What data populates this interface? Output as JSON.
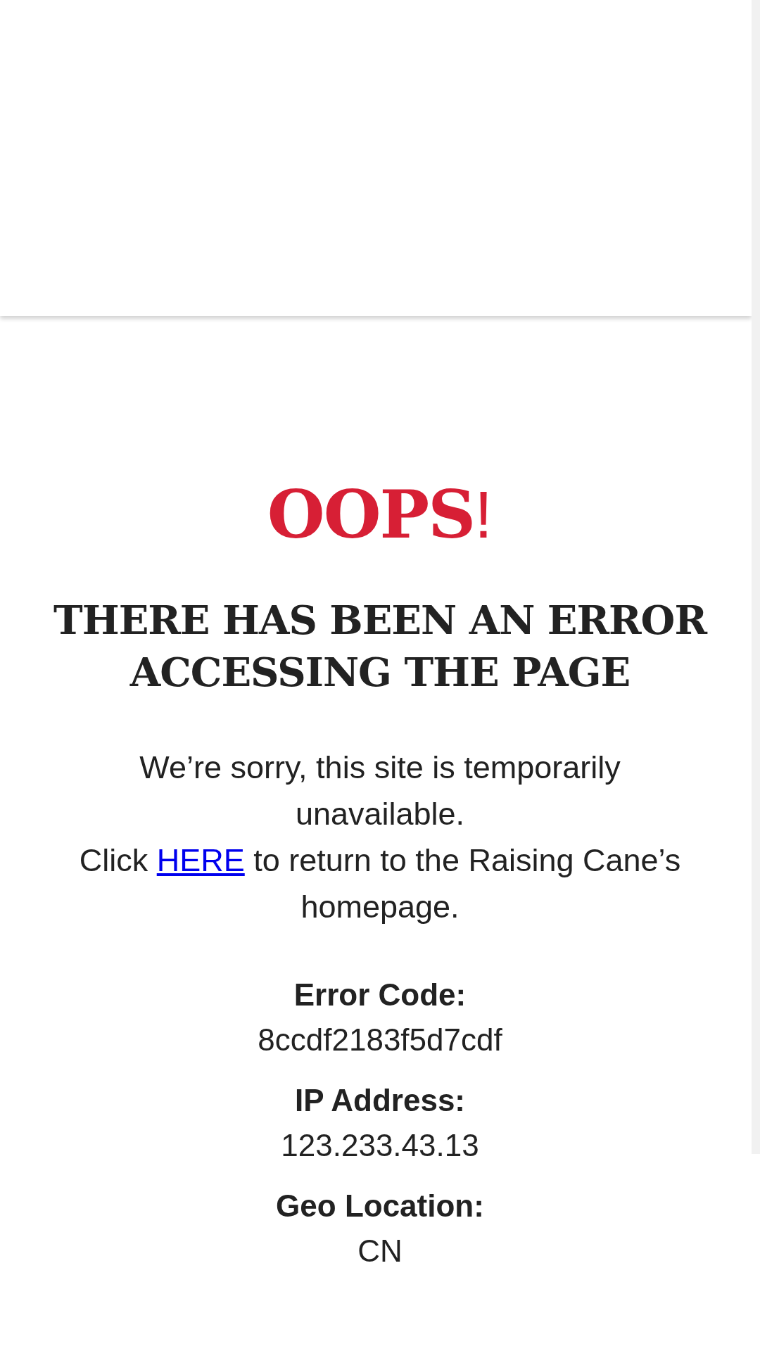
{
  "title": {
    "text": "OOPS",
    "mark": "!"
  },
  "heading": "THERE HAS BEEN AN ERROR ACCESSING THE PAGE",
  "message": "We’re sorry, this site is temporarily unavailable.",
  "return_line": {
    "before": "Click ",
    "link": "HERE",
    "after": " to return to the Raising Cane’s homepage."
  },
  "details": [
    {
      "label": "Error Code:",
      "value": "8ccdf2183f5d7cdf"
    },
    {
      "label": "IP Address:",
      "value": "123.233.43.13"
    },
    {
      "label": "Geo Location:",
      "value": "CN"
    }
  ]
}
